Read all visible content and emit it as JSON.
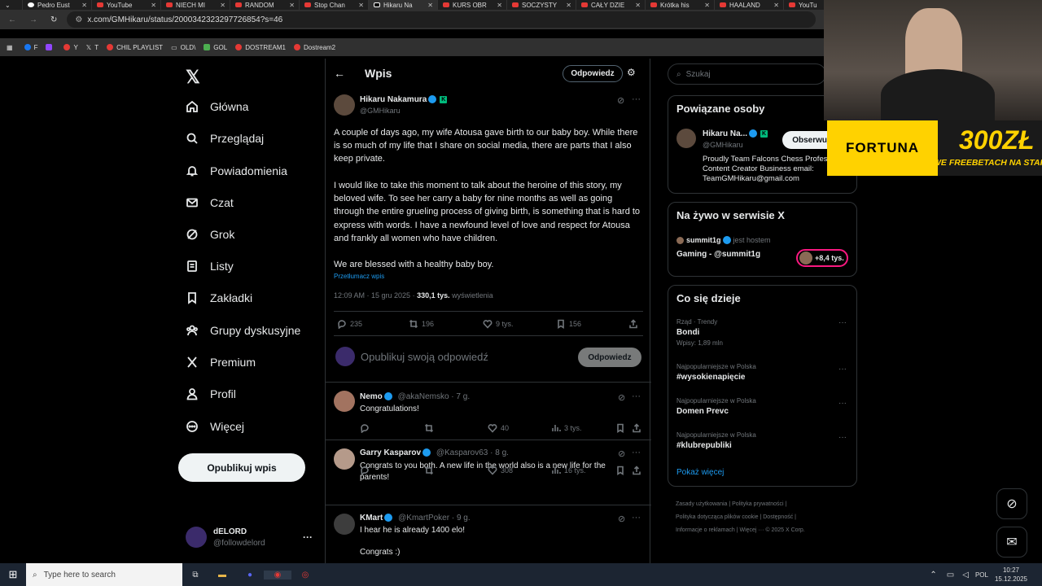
{
  "browser": {
    "tabs": [
      {
        "label": "Pedro Eust"
      },
      {
        "label": "YouTube"
      },
      {
        "label": "NIECH MI"
      },
      {
        "label": "RANDOM"
      },
      {
        "label": "Stop Chan"
      },
      {
        "label": "Hikaru Na"
      },
      {
        "label": "KURS OBR"
      },
      {
        "label": "SOCZYSTY"
      },
      {
        "label": "CAŁY DZIE"
      },
      {
        "label": "Krótka his"
      },
      {
        "label": "HAALAND"
      },
      {
        "label": "YouTu"
      }
    ],
    "url": "x.com/GMHikaru/status/2000342323297726854?s=46",
    "bookmarks": [
      "F",
      "Y",
      "T",
      "CHIL PLAYLIST",
      "OLD\\",
      "GOL",
      "DOSTREAM1",
      "Dostream2"
    ]
  },
  "sidebar": {
    "items": [
      {
        "label": "Główna",
        "icon": "home-icon"
      },
      {
        "label": "Przeglądaj",
        "icon": "search-icon"
      },
      {
        "label": "Powiadomienia",
        "icon": "bell-icon"
      },
      {
        "label": "Czat",
        "icon": "mail-icon"
      },
      {
        "label": "Grok",
        "icon": "grok-icon"
      },
      {
        "label": "Listy",
        "icon": "list-icon"
      },
      {
        "label": "Zakładki",
        "icon": "bookmark-icon"
      },
      {
        "label": "Grupy dyskusyjne",
        "icon": "people-icon"
      },
      {
        "label": "Premium",
        "icon": "x-icon"
      },
      {
        "label": "Profil",
        "icon": "person-icon"
      },
      {
        "label": "Więcej",
        "icon": "more-circle-icon"
      }
    ],
    "post_button": "Opublikuj wpis",
    "account_name": "dELORD",
    "account_handle": "@followdelord"
  },
  "header": {
    "title": "Wpis",
    "reply_button": "Odpowiedz"
  },
  "post": {
    "author": "Hikaru Nakamura",
    "handle": "@GMHikaru",
    "k_badge": "K",
    "paragraph1": "A couple of days ago, my wife Atousa gave birth to our baby boy. While there is so much of my life that I share on social media, there are parts that I also keep private.",
    "paragraph2": "I would like to take this moment to talk about the heroine of this story, my beloved wife. To see her carry a baby for nine months as well as going through the entire grueling process of giving birth, is something that is hard to express with words. I have a newfound level of love and respect for Atousa and frankly all women who have children.",
    "paragraph3": "We are blessed with a healthy baby boy.",
    "translate": "Przetłumacz wpis",
    "time": "12:09 AM · 15 gru 2025 · ",
    "views": "330,1 tys.",
    "views_label": " wyświetlenia",
    "replies": "235",
    "reposts": "196",
    "likes": "9 tys.",
    "bookmarks": "156"
  },
  "composer": {
    "placeholder": "Opublikuj swoją odpowiedź",
    "button": "Odpowiedz"
  },
  "replies": [
    {
      "name": "Nemo",
      "handle": "@akaNemsko · 7 g.",
      "text": "Congratulations!",
      "replies": "",
      "reposts": "",
      "likes": "40",
      "views": "3 tys."
    },
    {
      "name": "Garry Kasparov",
      "handle": "@Kasparov63 · 8 g.",
      "text": "Congrats to you both. A new life in the world also is a new life for the parents!",
      "replies": "",
      "reposts": "",
      "likes": "308",
      "views": "16 tys."
    },
    {
      "name": "KMart",
      "handle": "@KmartPoker · 9 g.",
      "text": "I hear he is already 1400 elo!",
      "text2": "Congrats :)"
    }
  ],
  "right": {
    "search_placeholder": "Szukaj",
    "related_title": "Powiązane osoby",
    "related_name": "Hikaru Na...",
    "related_handle": "@GMHikaru",
    "follow_button": "Obserwuj",
    "related_bio": "Proudly Team Falcons Chess Professional Content Creator Business email: TeamGMHikaru@gmail.com",
    "live_title": "Na żywo w serwisie X",
    "live_user": "summit1g",
    "live_status": "jest hostem",
    "live_text": "Gaming - @summit1g",
    "live_count": "+8,4 tys.",
    "trends_title": "Co się dzieje",
    "trends": [
      {
        "meta": "Rząd · Trendy",
        "name": "Bondi",
        "sub": "Wpisy: 1,89 mln"
      },
      {
        "meta": "Najpopularniejsze w Polska",
        "name": "#wysokienapięcie",
        "sub": ""
      },
      {
        "meta": "Najpopularniejsze w Polska",
        "name": "Domen Prevc",
        "sub": ""
      },
      {
        "meta": "Najpopularniejsze w Polska",
        "name": "#klubrepubliki",
        "sub": ""
      }
    ],
    "show_more": "Pokaż więcej",
    "footer1": "Zasady użytkowania  |  Polityka prywatności  |",
    "footer2": "Polityka dotycząca plików cookie  |  Dostępność  |",
    "footer3": "Informacje o reklamach  |  Więcej ···  © 2025 X Corp."
  },
  "overlay": {
    "brand": "FORTUNA",
    "promo_big": "300ZŁ",
    "promo_small": "WE FREEBETACH NA STAR"
  },
  "taskbar": {
    "search_placeholder": "Type here to search",
    "lang": "POL",
    "time": "10:27",
    "date": "15.12.2025"
  }
}
